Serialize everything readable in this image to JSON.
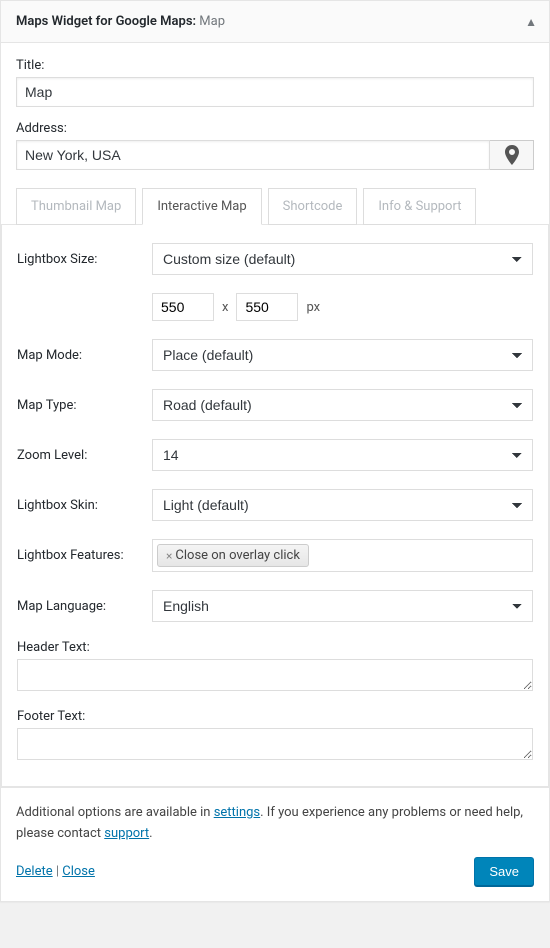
{
  "header": {
    "title": "Maps Widget for Google Maps:",
    "subtitle": "Map"
  },
  "title": {
    "label": "Title:",
    "value": "Map"
  },
  "address": {
    "label": "Address:",
    "value": "New York, USA"
  },
  "tabs": {
    "thumbnail": "Thumbnail Map",
    "interactive": "Interactive Map",
    "shortcode": "Shortcode",
    "info": "Info & Support"
  },
  "fields": {
    "lightbox_size": {
      "label": "Lightbox Size:",
      "value": "Custom size (default)",
      "w": "550",
      "h": "550",
      "sep": "x",
      "unit": "px"
    },
    "map_mode": {
      "label": "Map Mode:",
      "value": "Place (default)"
    },
    "map_type": {
      "label": "Map Type:",
      "value": "Road (default)"
    },
    "zoom": {
      "label": "Zoom Level:",
      "value": "14"
    },
    "skin": {
      "label": "Lightbox Skin:",
      "value": "Light (default)"
    },
    "features": {
      "label": "Lightbox Features:",
      "tag": "Close on overlay click"
    },
    "language": {
      "label": "Map Language:",
      "value": "English"
    },
    "header_text": {
      "label": "Header Text:",
      "value": ""
    },
    "footer_text": {
      "label": "Footer Text:",
      "value": ""
    }
  },
  "footer": {
    "text1": "Additional options are available in ",
    "link1": "settings",
    "text2": ". If you experience any problems or need help, please contact ",
    "link2": "support",
    "text3": ".",
    "delete": "Delete",
    "sep": " | ",
    "close": "Close",
    "save": "Save"
  }
}
